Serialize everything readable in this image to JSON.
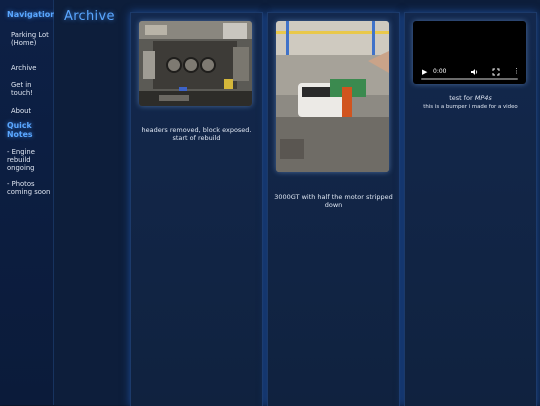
{
  "sidebar": {
    "heading": "Navigation",
    "links": [
      {
        "label": "Parking Lot (Home)"
      },
      {
        "label": "Archive"
      },
      {
        "label": "Get in touch!"
      },
      {
        "label": "About"
      }
    ],
    "notes_heading": "Quick Notes",
    "notes": [
      {
        "text": "- Engine rebuild ongoing"
      },
      {
        "text": "- Photos coming soon"
      }
    ]
  },
  "main": {
    "title": "Archive",
    "cards": [
      {
        "caption": "headers removed, block exposed. start of rebuild"
      },
      {
        "caption": "3000GT with half the motor stripped down"
      },
      {
        "caption_prefix": "test for ",
        "caption_emphasis": "MP4s",
        "caption_small": "this is a bumper i made for a video",
        "video": {
          "time": "0:00",
          "progress": 0
        }
      }
    ]
  },
  "colors": {
    "accent": "#5aa7ff",
    "background": "#0d1e3b",
    "text": "#dfe6f2"
  }
}
